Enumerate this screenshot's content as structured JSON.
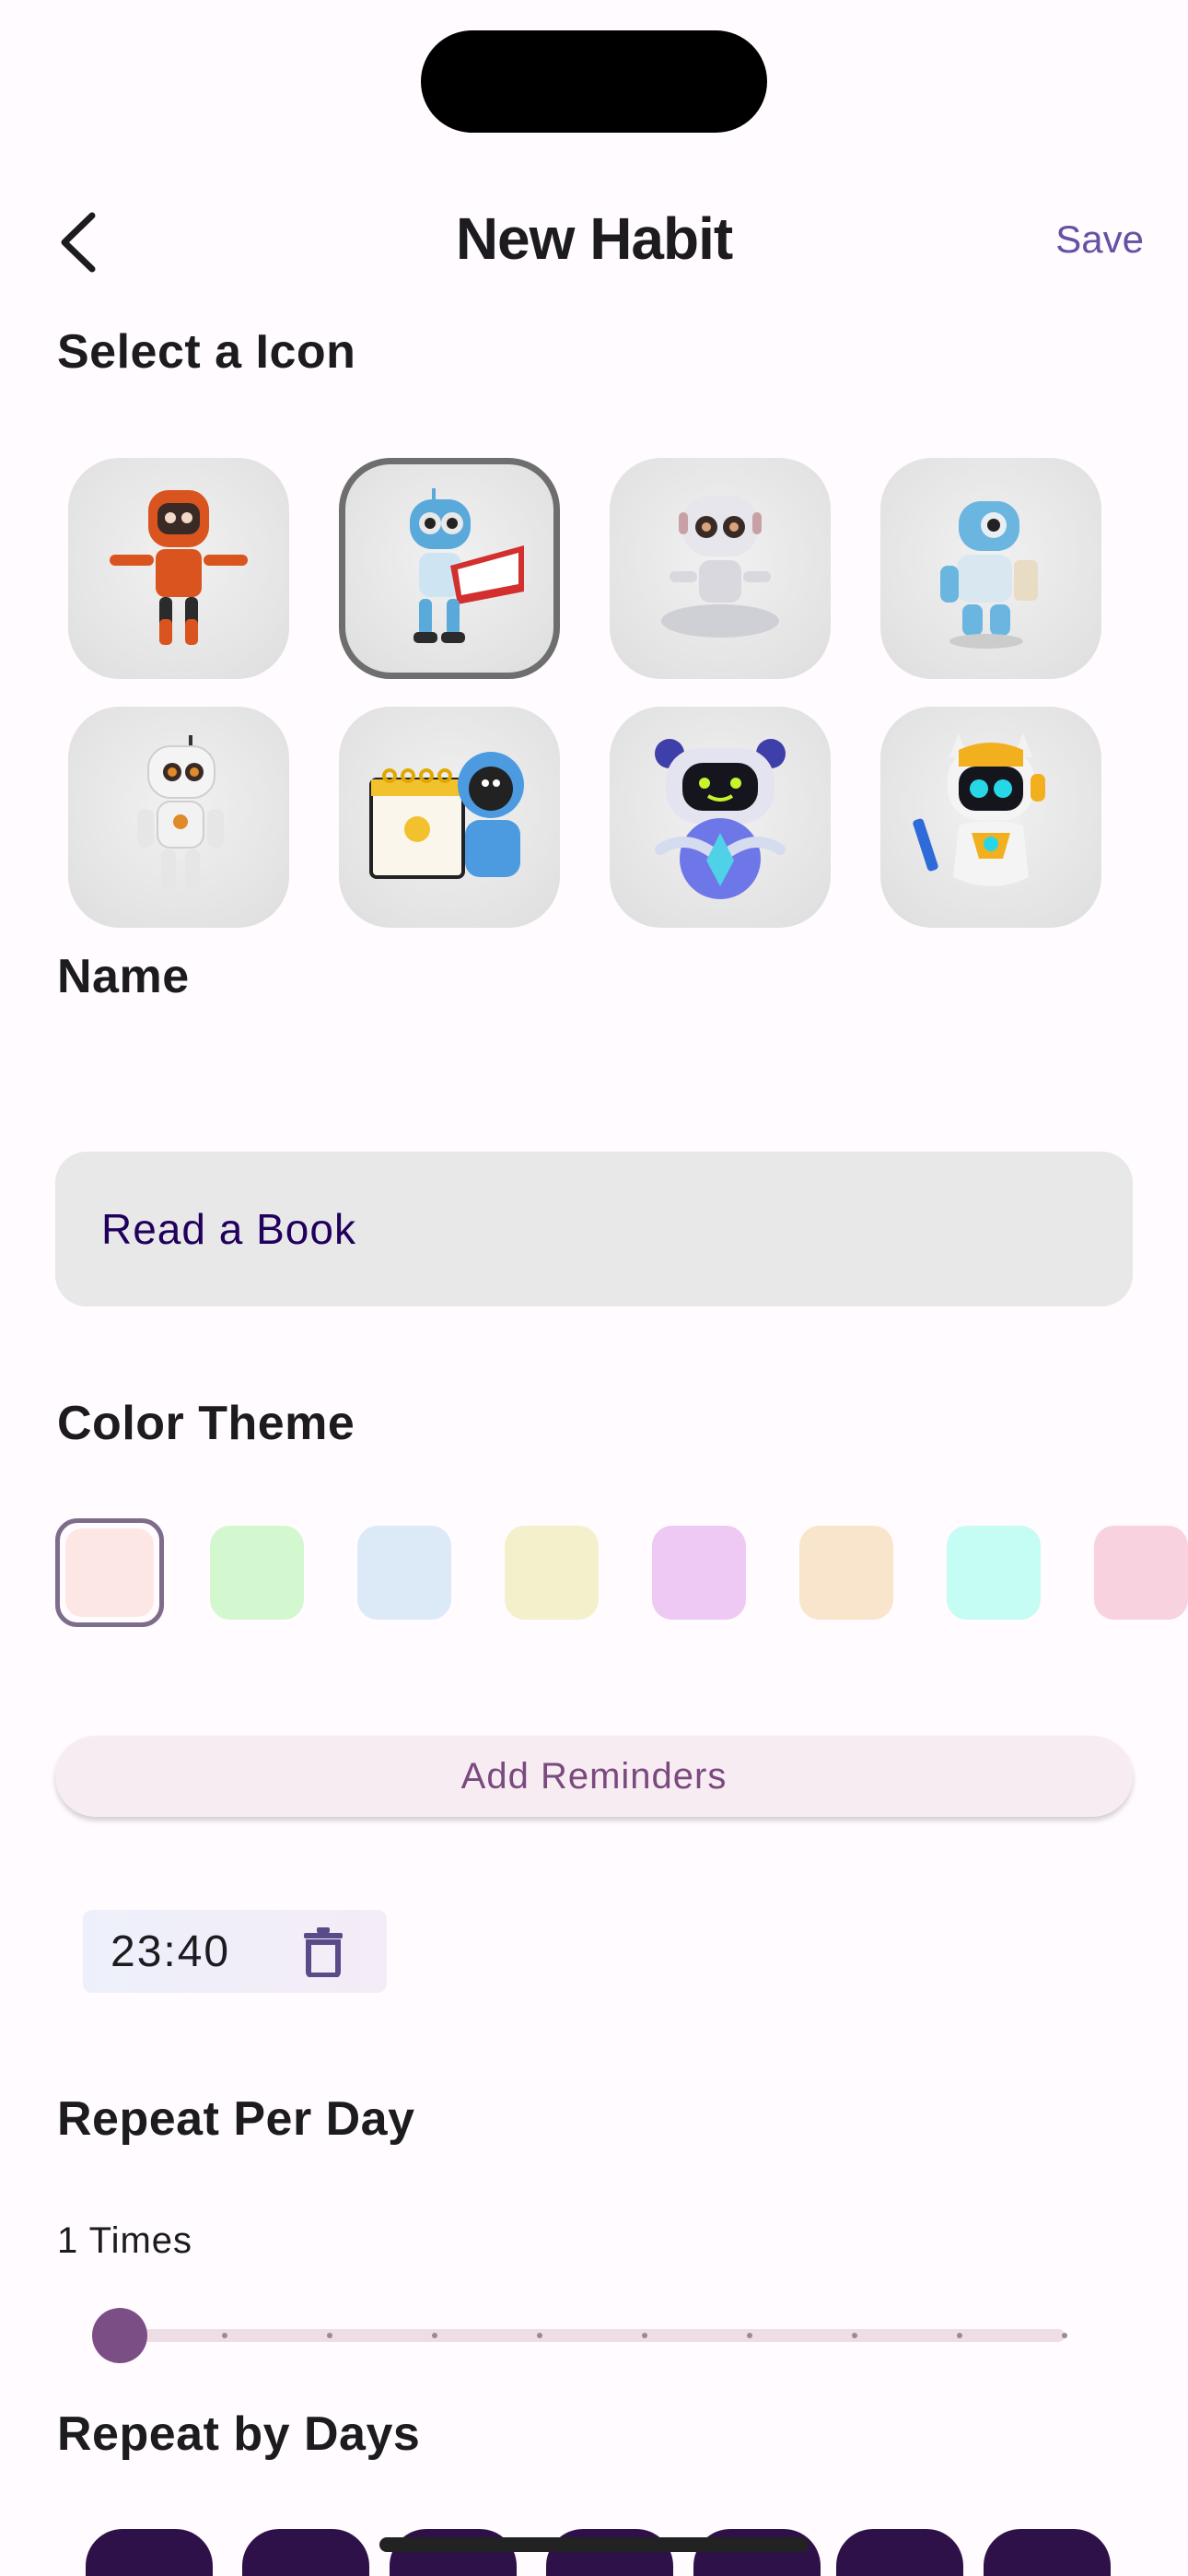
{
  "header": {
    "title": "New Habit",
    "save_label": "Save",
    "back_icon": "chevron-left-icon"
  },
  "icon_section": {
    "title": "Select a Icon",
    "selected_index": 1,
    "icons": [
      {
        "name": "orange-robot-icon",
        "color": "#D9541E"
      },
      {
        "name": "reading-robot-icon",
        "color": "#5AA9DB"
      },
      {
        "name": "meditating-robot-icon",
        "color": "#D8D8DE"
      },
      {
        "name": "drinking-robot-icon",
        "color": "#6BB6E0"
      },
      {
        "name": "white-robot-icon",
        "color": "#F2F2F2"
      },
      {
        "name": "calendar-robot-icon",
        "color": "#4C9BE0"
      },
      {
        "name": "blue-ai-robot-icon",
        "color": "#6E77E8"
      },
      {
        "name": "yellow-writing-robot-icon",
        "color": "#F2B01E"
      }
    ]
  },
  "name_section": {
    "title": "Name",
    "value": "Read a Book"
  },
  "color_section": {
    "title": "Color Theme",
    "selected_index": 0,
    "colors": [
      "#FDE7E4",
      "#D3F7CF",
      "#DCEAF8",
      "#F3F0CB",
      "#EDC9F3",
      "#F8E5CB",
      "#C5FCF4",
      "#F8D2DE"
    ]
  },
  "reminders": {
    "add_label": "Add Reminders",
    "items": [
      {
        "time": "23:40",
        "delete_icon": "trash-icon"
      }
    ]
  },
  "repeat_per_day": {
    "title": "Repeat Per Day",
    "value_label": "1 Times",
    "value": 1,
    "min": 1,
    "max": 10
  },
  "repeat_by_days": {
    "title": "Repeat by Days",
    "day_count": 7
  }
}
